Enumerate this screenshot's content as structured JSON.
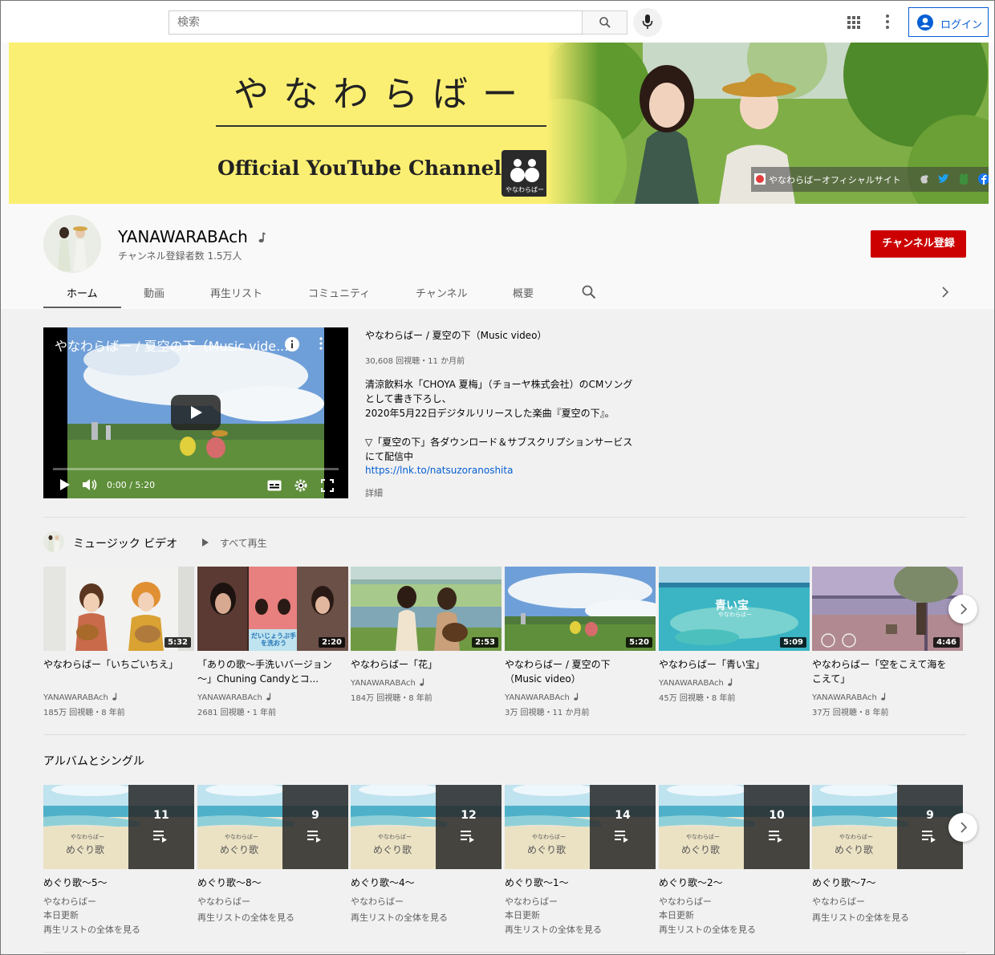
{
  "search": {
    "placeholder": "検索"
  },
  "header": {
    "login_label": "ログイン"
  },
  "banner": {
    "title": "やなわらばー",
    "subtitle": "Official YouTube  Channel",
    "logo_text": "やなわらばー",
    "site_link": "やなわらばーオフィシャルサイト"
  },
  "channel": {
    "name": "YANAWARABAch",
    "subscribers": "チャンネル登録者数 1.5万人",
    "subscribe_label": "チャンネル登録"
  },
  "tabs": [
    {
      "label": "ホーム"
    },
    {
      "label": "動画"
    },
    {
      "label": "再生リスト"
    },
    {
      "label": "コミュニティ"
    },
    {
      "label": "チャンネル"
    },
    {
      "label": "概要"
    }
  ],
  "featured": {
    "player_title": "やなわらばー / 夏空の下（Music vide...",
    "time": "0:00 / 5:20",
    "progress": 0,
    "title": "やなわらばー / 夏空の下（Music video）",
    "meta": "30,608 回視聴・11 か月前",
    "description": "清涼飲料水「CHOYA 夏梅」（チョーヤ株式会社）のCMソング\nとして書き下ろし、\n2020年5月22日デジタルリリースした楽曲『夏空の下』。\n\n▽「夏空の下」各ダウンロード＆サブスクリプションサービス\nにて配信中",
    "link": "https://lnk.to/natsuzoranoshita",
    "more": "詳細"
  },
  "music_shelf": {
    "title": "ミュージック ビデオ",
    "play_all": "すべて再生",
    "videos": [
      {
        "title": "やなわらばー「いちごいちえ」",
        "duration": "5:32",
        "channel": "YANAWARABAch",
        "meta": "185万 回視聴・8 年前"
      },
      {
        "title": "「ありの歌～手洗いバージョン～」Chuning Candyとコ...",
        "duration": "2:20",
        "channel": "YANAWARABAch",
        "meta": "2681 回視聴・1 年前"
      },
      {
        "title": "やなわらばー「花」",
        "duration": "2:53",
        "channel": "YANAWARABAch",
        "meta": "184万 回視聴・8 年前"
      },
      {
        "title": "やなわらばー / 夏空の下（Music video）",
        "duration": "5:20",
        "channel": "YANAWARABAch",
        "meta": "3万 回視聴・11 か月前"
      },
      {
        "title": "やなわらばー「青い宝」",
        "duration": "5:09",
        "channel": "YANAWARABAch",
        "meta": "45万 回視聴・8 年前"
      },
      {
        "title": "やなわらばー「空をこえて海をこえて」",
        "duration": "4:46",
        "channel": "YANAWARABAch",
        "meta": "37万 回視聴・8 年前"
      }
    ],
    "thumb3_caption": "青い宝",
    "thumb3_sub": "やなわらばー",
    "thumb1_caption": "だいじょうぶ手を洗おう"
  },
  "album_shelf": {
    "title": "アルバムとシングル",
    "art_text_top": "やなわらばー",
    "art_text_main": "めぐり歌",
    "playlists": [
      {
        "title": "めぐり歌～5～",
        "count": "11",
        "author": "やなわらばー",
        "updated": "本日更新",
        "view_all": "再生リストの全体を見る"
      },
      {
        "title": "めぐり歌～8～",
        "count": "9",
        "author": "やなわらばー",
        "updated": "",
        "view_all": "再生リストの全体を見る"
      },
      {
        "title": "めぐり歌～4～",
        "count": "12",
        "author": "やなわらばー",
        "updated": "",
        "view_all": "再生リストの全体を見る"
      },
      {
        "title": "めぐり歌～1～",
        "count": "14",
        "author": "やなわらばー",
        "updated": "本日更新",
        "view_all": "再生リストの全体を見る"
      },
      {
        "title": "めぐり歌～2～",
        "count": "10",
        "author": "やなわらばー",
        "updated": "本日更新",
        "view_all": "再生リストの全体を見る"
      },
      {
        "title": "めぐり歌～7～",
        "count": "9",
        "author": "やなわらばー",
        "updated": "",
        "view_all": "再生リストの全体を見る"
      }
    ]
  },
  "colors": {
    "banner_bg": "#fbef73",
    "subscribe_red": "#cc0000",
    "link_blue": "#065fd4",
    "sky": "#6f9fd8",
    "grass": "#5f8f3a"
  },
  "icons": {
    "search": "search-icon",
    "mic": "mic-icon",
    "apps": "apps-grid-icon",
    "more": "more-vert-icon",
    "account": "account-circle-icon",
    "play": "play-icon",
    "volume": "volume-icon",
    "captions": "captions-icon",
    "settings": "gear-icon",
    "fullscreen": "fullscreen-icon",
    "playlist": "playlist-icon",
    "next": "chevron-right-icon"
  }
}
